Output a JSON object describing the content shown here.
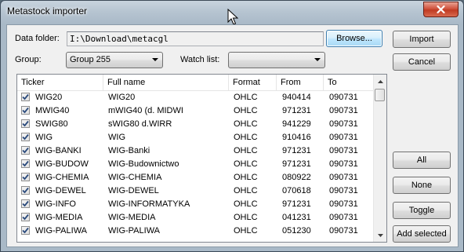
{
  "window": {
    "title": "Metastock importer"
  },
  "form": {
    "data_folder_label": "Data folder:",
    "data_folder_value": "I:\\Download\\metacgl",
    "group_label": "Group:",
    "group_value": "Group 255",
    "watch_list_label": "Watch list:",
    "watch_list_value": ""
  },
  "buttons": {
    "browse": "Browse...",
    "import": "Import",
    "cancel": "Cancel",
    "all": "All",
    "none": "None",
    "toggle": "Toggle",
    "add_selected": "Add selected"
  },
  "table": {
    "columns": [
      "Ticker",
      "Full name",
      "Format",
      "From",
      "To"
    ],
    "rows": [
      {
        "checked": true,
        "ticker": "WIG20",
        "name": "WIG20",
        "format": "OHLC",
        "from": "940414",
        "to": "090731"
      },
      {
        "checked": true,
        "ticker": "MWIG40",
        "name": "mWIG40 (d. MIDWI",
        "format": "OHLC",
        "from": "971231",
        "to": "090731"
      },
      {
        "checked": true,
        "ticker": "SWIG80",
        "name": "sWIG80 d.WIRR",
        "format": "OHLC",
        "from": "941229",
        "to": "090731"
      },
      {
        "checked": true,
        "ticker": "WIG",
        "name": "WIG",
        "format": "OHLC",
        "from": "910416",
        "to": "090731"
      },
      {
        "checked": true,
        "ticker": "WIG-BANKI",
        "name": "WIG-Banki",
        "format": "OHLC",
        "from": "971231",
        "to": "090731"
      },
      {
        "checked": true,
        "ticker": "WIG-BUDOW",
        "name": "WIG-Budownictwo",
        "format": "OHLC",
        "from": "971231",
        "to": "090731"
      },
      {
        "checked": true,
        "ticker": "WIG-CHEMIA",
        "name": "WIG-CHEMIA",
        "format": "OHLC",
        "from": "080922",
        "to": "090731"
      },
      {
        "checked": true,
        "ticker": "WIG-DEWEL",
        "name": "WIG-DEWEL",
        "format": "OHLC",
        "from": "070618",
        "to": "090731"
      },
      {
        "checked": true,
        "ticker": "WIG-INFO",
        "name": "WIG-INFORMATYKA",
        "format": "OHLC",
        "from": "971231",
        "to": "090731"
      },
      {
        "checked": true,
        "ticker": "WIG-MEDIA",
        "name": "WIG-MEDIA",
        "format": "OHLC",
        "from": "041231",
        "to": "090731"
      },
      {
        "checked": true,
        "ticker": "WIG-PALIWA",
        "name": "WIG-PALIWA",
        "format": "OHLC",
        "from": "051230",
        "to": "090731"
      }
    ]
  },
  "icons": {
    "close": "close-icon",
    "checkbox": "checkmark-icon",
    "cursor": "mouse-pointer-icon"
  },
  "colors": {
    "checkmark": "#2a4a7c",
    "close_button": "#c8452e",
    "default_button_border": "#3c7fb1"
  }
}
